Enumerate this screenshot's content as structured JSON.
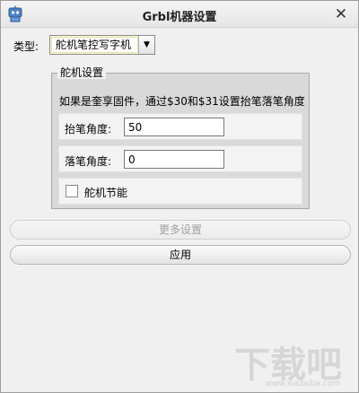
{
  "window": {
    "title": "Grbl机器设置",
    "close_glyph": "✕",
    "app_icon": "robot-icon"
  },
  "type_selector": {
    "label": "类型:",
    "value": "舵机笔控写字机",
    "arrow_glyph": "▼"
  },
  "servo_group": {
    "title": "舵机设置",
    "note": "如果是奎享固件，通过$30和$31设置抬笔落笔角度",
    "lift_angle": {
      "label": "抬笔角度:",
      "value": "50"
    },
    "drop_angle": {
      "label": "落笔角度:",
      "value": "0"
    },
    "energy_saving": {
      "label": "舵机节能",
      "checked": false
    }
  },
  "buttons": {
    "more_settings": "更多设置",
    "apply": "应用"
  },
  "watermark": {
    "text": "下载吧",
    "sub": "www.xiazaiba.com"
  }
}
